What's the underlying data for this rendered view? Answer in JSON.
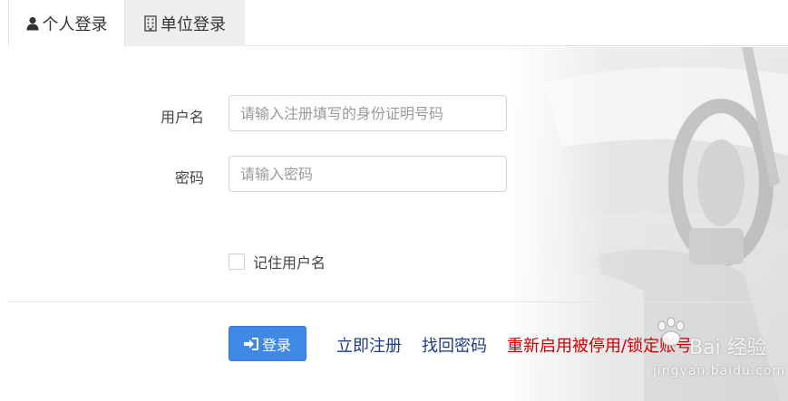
{
  "tabs": {
    "personal_label": "个人登录",
    "unit_label": "单位登录"
  },
  "form": {
    "username_label": "用户名",
    "username_placeholder": "请输入注册填写的身份证明号码",
    "password_label": "密码",
    "password_placeholder": "请输入密码",
    "remember_label": "记住用户名"
  },
  "actions": {
    "login_label": "登录",
    "register_link": "立即注册",
    "recover_link": "找回密码",
    "reactivate_link": "重新启用被停用/锁定账号"
  },
  "watermark": {
    "brand": "Bai 经验",
    "url": "jingyan.baidu.com"
  },
  "colors": {
    "primary_button": "#3f88e6",
    "link_blue": "#1e3a8a",
    "link_red": "#d10000",
    "tab_inactive_bg": "#eeeeee"
  }
}
